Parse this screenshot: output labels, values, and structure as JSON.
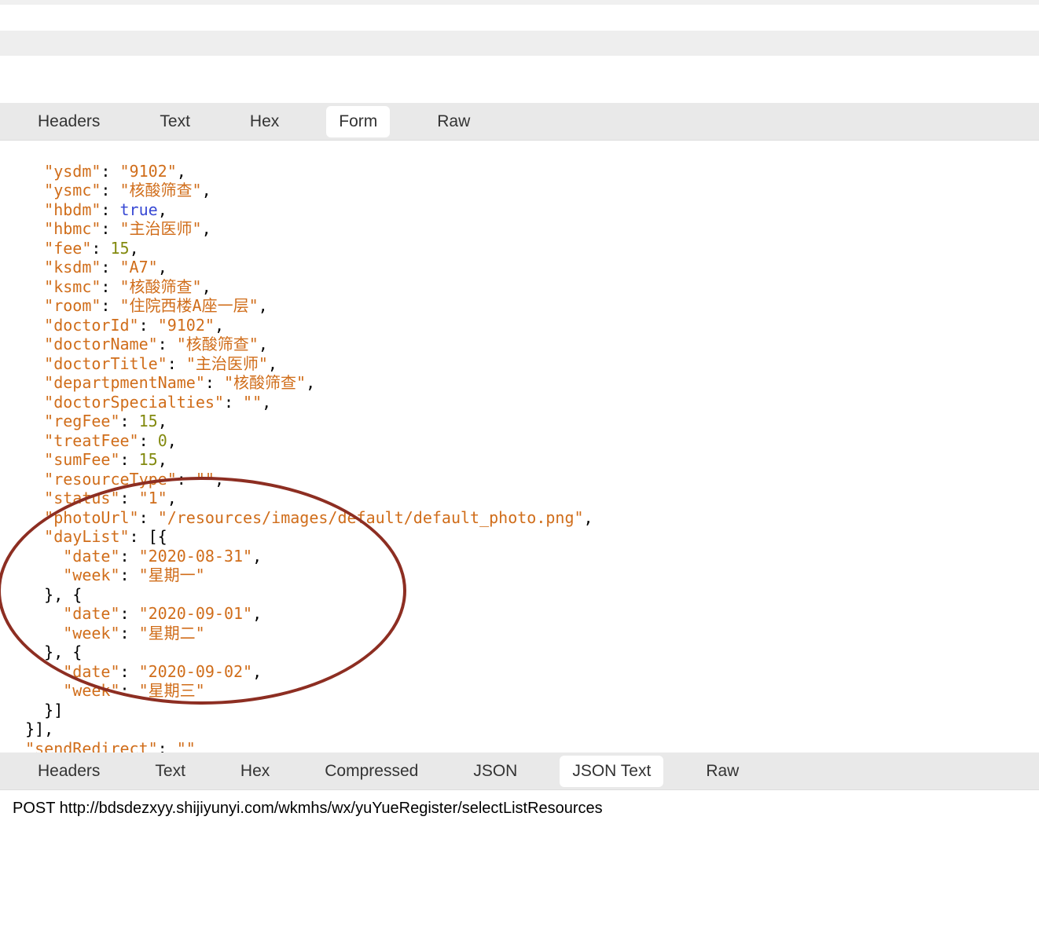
{
  "topTabs": {
    "headers": "Headers",
    "text": "Text",
    "hex": "Hex",
    "form": "Form",
    "raw": "Raw"
  },
  "bottomTabs": {
    "headers": "Headers",
    "text": "Text",
    "hex": "Hex",
    "compressed": "Compressed",
    "json": "JSON",
    "jsonText": "JSON Text",
    "raw": "Raw"
  },
  "json": {
    "ysdm_k": "\"ysdm\"",
    "ysdm_v": "\"9102\"",
    "ysmc_k": "\"ysmc\"",
    "ysmc_v": "\"核酸筛查\"",
    "hbdm_k": "\"hbdm\"",
    "hbdm_v": "true",
    "hbmc_k": "\"hbmc\"",
    "hbmc_v": "\"主治医师\"",
    "fee_k": "\"fee\"",
    "fee_v": "15",
    "ksdm_k": "\"ksdm\"",
    "ksdm_v": "\"A7\"",
    "ksmc_k": "\"ksmc\"",
    "ksmc_v": "\"核酸筛查\"",
    "room_k": "\"room\"",
    "room_v": "\"住院西楼A座一层\"",
    "doctorId_k": "\"doctorId\"",
    "doctorId_v": "\"9102\"",
    "doctorName_k": "\"doctorName\"",
    "doctorName_v": "\"核酸筛查\"",
    "doctorTitle_k": "\"doctorTitle\"",
    "doctorTitle_v": "\"主治医师\"",
    "departpmentName_k": "\"departpmentName\"",
    "departpmentName_v": "\"核酸筛查\"",
    "doctorSpecialties_k": "\"doctorSpecialties\"",
    "doctorSpecialties_v": "\"\"",
    "regFee_k": "\"regFee\"",
    "regFee_v": "15",
    "treatFee_k": "\"treatFee\"",
    "treatFee_v": "0",
    "sumFee_k": "\"sumFee\"",
    "sumFee_v": "15",
    "resourceType_k": "\"resourceType\"",
    "resourceType_v": "\"\"",
    "status_k": "\"status\"",
    "status_v": "\"1\"",
    "photoUrl_k": "\"photoUrl\"",
    "photoUrl_v": "\"/resources/images/default/default_photo.png\"",
    "dayList_k": "\"dayList\"",
    "date_k": "\"date\"",
    "week_k": "\"week\"",
    "day0_date": "\"2020-08-31\"",
    "day0_week": "\"星期一\"",
    "day1_date": "\"2020-09-01\"",
    "day1_week": "\"星期二\"",
    "day2_date": "\"2020-09-02\"",
    "day2_week": "\"星期三\"",
    "sendRedirect_k": "\"sendRedirect\"",
    "sendRedirect_v": "\"\""
  },
  "requestLine": "POST http://bdsdezxyy.shijiyunyi.com/wkmhs/wx/yuYueRegister/selectListResources"
}
